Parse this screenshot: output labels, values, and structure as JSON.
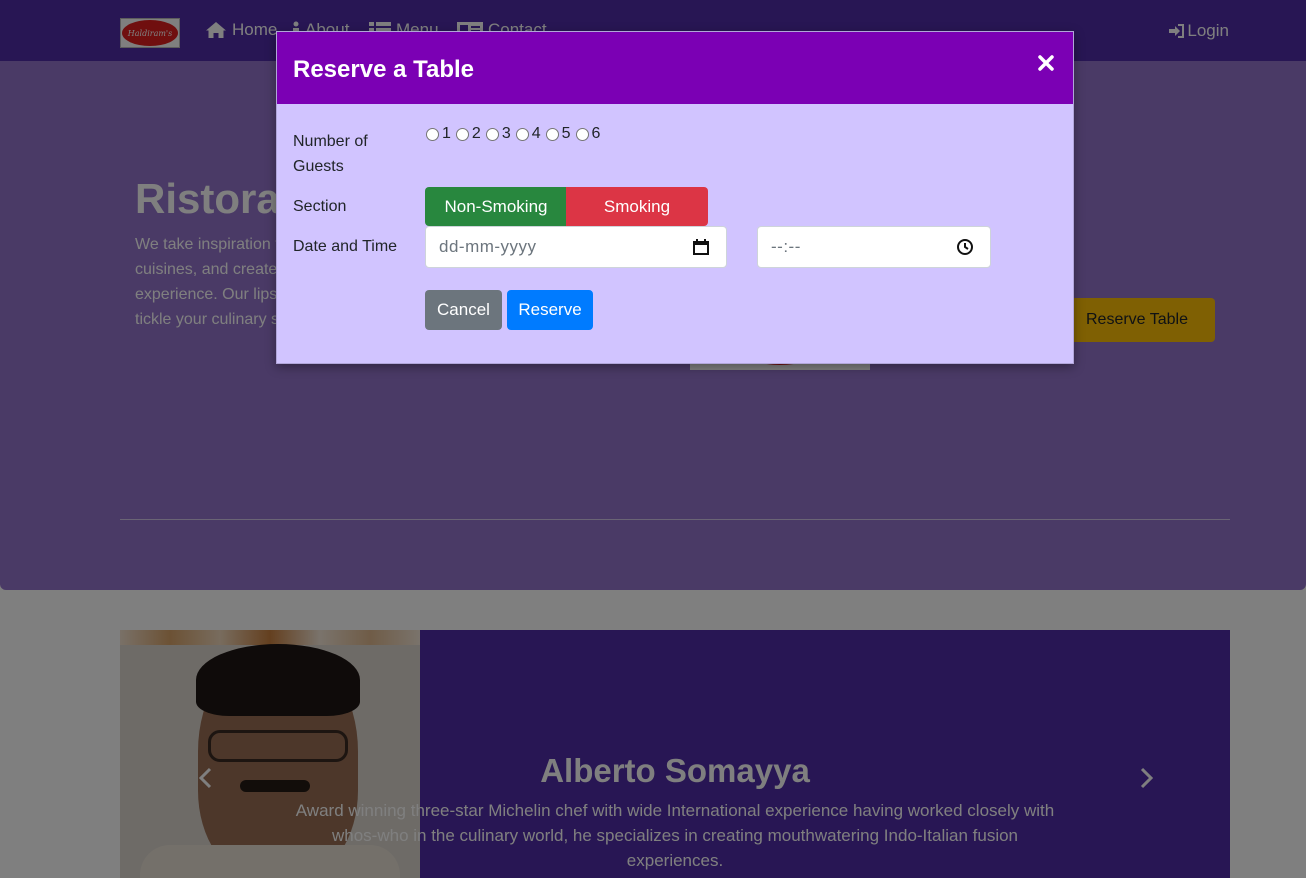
{
  "navbar": {
    "logo_text": "Haldiram's",
    "links": [
      {
        "label": "Home",
        "icon": "home-icon"
      },
      {
        "label": "About",
        "icon": "info-icon"
      },
      {
        "label": "Menu",
        "icon": "list-icon"
      },
      {
        "label": "Contact",
        "icon": "address-card-icon"
      }
    ],
    "login": {
      "label": "Login",
      "icon": "sign-in-icon"
    }
  },
  "hero": {
    "title": "Ristorante con Fusion",
    "text": "We take inspiration from the World's best cuisines, and create a unique fusion experience. Our lipsmacking creations will tickle your culinary senses!",
    "reserve_button": "Reserve Table"
  },
  "chef": {
    "name": "Alberto Somayya",
    "bio": "Award winning three-star Michelin chef with wide International experience having worked closely with whos-who in the culinary world, he specializes in creating mouthwatering Indo-Italian fusion experiences."
  },
  "modal": {
    "title": "Reserve a Table",
    "close_icon": "close-icon",
    "guests_label": "Number of Guests",
    "guest_options": [
      "1",
      "2",
      "3",
      "4",
      "5",
      "6"
    ],
    "section_label": "Section",
    "section_options": {
      "non_smoking": "Non-Smoking",
      "smoking": "Smoking"
    },
    "datetime_label": "Date and Time",
    "date_placeholder": "dd-mm-yyyy",
    "time_placeholder": "--:--",
    "cancel_label": "Cancel",
    "reserve_label": "Reserve"
  },
  "colors": {
    "navbar": "#512da8",
    "jumbotron": "#9575cd",
    "modal_header": "#7b00b4",
    "modal_body": "#d1c4ff",
    "non_smoking": "#28873e",
    "smoking": "#dc3545",
    "cancel": "#6c757d",
    "reserve": "#007bff",
    "reserve_table": "#ffc107"
  }
}
